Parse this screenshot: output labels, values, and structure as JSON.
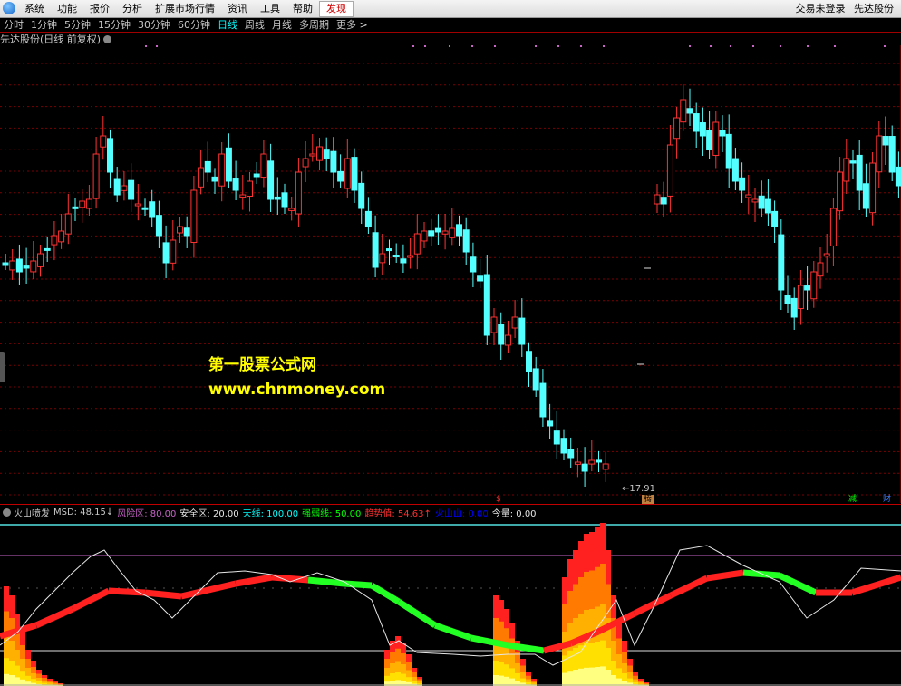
{
  "menu": {
    "items": [
      "系统",
      "功能",
      "报价",
      "分析",
      "扩展市场行情",
      "资讯",
      "工具",
      "帮助",
      "发现"
    ],
    "highlight_index": 8,
    "right": [
      "交易未登录",
      "先达股份"
    ]
  },
  "periods": {
    "items": [
      "分时",
      "1分钟",
      "5分钟",
      "15分钟",
      "30分钟",
      "60分钟",
      "日线",
      "周线",
      "月线",
      "多周期",
      "更多 >"
    ],
    "active_index": 6
  },
  "stock": {
    "title": "先达股份(日线 前复权)"
  },
  "watermark": {
    "line1": "第一股票公式网",
    "line2": "www.chnmoney.com"
  },
  "price_label": "←17.91",
  "indicator": {
    "name": "火山喷发",
    "items": [
      {
        "text": "MSD: 48.15↓",
        "color": "#c8c8c8"
      },
      {
        "text": "风险区: 80.00",
        "color": "#c864c8"
      },
      {
        "text": "安全区: 20.00",
        "color": "#e6e6e6"
      },
      {
        "text": "天线: 100.00",
        "color": "#00ffff"
      },
      {
        "text": "强弱线: 50.00",
        "color": "#00ff00"
      },
      {
        "text": "趋势值: 54.63↑",
        "color": "#ff3030"
      },
      {
        "text": "火山山: 0.00",
        "color": "#0000ff"
      },
      {
        "text": "今量: 0.00",
        "color": "#e6e6e6"
      }
    ]
  },
  "markers": {
    "s_label": "$",
    "tag1": "腾",
    "tag2": "减",
    "tag3": "财"
  },
  "colors": {
    "up": "#ff3232",
    "down": "#54ffff",
    "grid": "#7a0000"
  }
}
